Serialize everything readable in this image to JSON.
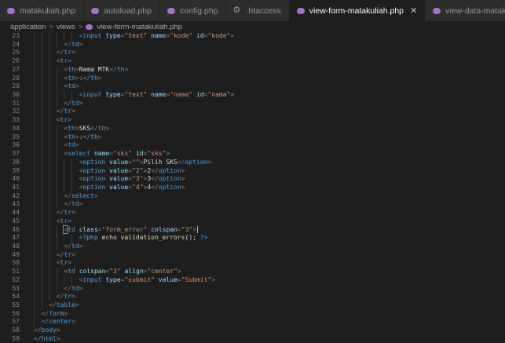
{
  "tabs": [
    {
      "label": "matakuliah.php",
      "icon": "php-icon",
      "active": false
    },
    {
      "label": "autoload.php",
      "icon": "php-icon",
      "active": false
    },
    {
      "label": "config.php",
      "icon": "php-icon",
      "active": false
    },
    {
      "label": ".htaccess",
      "icon": "gear-icon",
      "active": false
    },
    {
      "label": "view-form-matakuliah.php",
      "icon": "php-icon",
      "active": true
    },
    {
      "label": "view-data-matakuliah.php",
      "icon": "php-icon",
      "active": false
    }
  ],
  "close_glyph": "✕",
  "breadcrumb": {
    "items": [
      "application",
      "views",
      "view-form-matakuliah.php"
    ],
    "separator": ">"
  },
  "colors": {
    "tag": "#569cd6",
    "attribute": "#9cdcfe",
    "string": "#ce9178",
    "text": "#d4d4d4",
    "function": "#dcdcaa",
    "line_number": "#858585",
    "php_icon": "#a074c4"
  },
  "lines": [
    {
      "n": "23",
      "indent": 12,
      "tokens": [
        [
          "t",
          "<"
        ],
        [
          "tag",
          "input"
        ],
        [
          "t",
          " "
        ],
        [
          "attr",
          "type"
        ],
        [
          "t",
          "="
        ],
        [
          "str",
          "\"text\""
        ],
        [
          "t",
          " "
        ],
        [
          "attr",
          "name"
        ],
        [
          "t",
          "="
        ],
        [
          "str",
          "\"kode\""
        ],
        [
          "t",
          " "
        ],
        [
          "attr",
          "id"
        ],
        [
          "t",
          "="
        ],
        [
          "str",
          "\"kode\""
        ],
        [
          "t",
          ">"
        ]
      ]
    },
    {
      "n": "24",
      "indent": 8,
      "tokens": [
        [
          "t",
          "</"
        ],
        [
          "tag",
          "td"
        ],
        [
          "t",
          ">"
        ]
      ]
    },
    {
      "n": "25",
      "indent": 6,
      "tokens": [
        [
          "t",
          "</"
        ],
        [
          "tag",
          "tr"
        ],
        [
          "t",
          ">"
        ]
      ]
    },
    {
      "n": "26",
      "indent": 6,
      "tokens": [
        [
          "t",
          "<"
        ],
        [
          "tag",
          "tr"
        ],
        [
          "t",
          ">"
        ]
      ]
    },
    {
      "n": "27",
      "indent": 8,
      "tokens": [
        [
          "t",
          "<"
        ],
        [
          "tag",
          "th"
        ],
        [
          "t",
          ">"
        ],
        [
          "txt",
          "Nama MTK"
        ],
        [
          "t",
          "</"
        ],
        [
          "tag",
          "th"
        ],
        [
          "t",
          ">"
        ]
      ]
    },
    {
      "n": "28",
      "indent": 8,
      "tokens": [
        [
          "t",
          "<"
        ],
        [
          "tag",
          "th"
        ],
        [
          "t",
          ">"
        ],
        [
          "txt",
          ":"
        ],
        [
          "t",
          "</"
        ],
        [
          "tag",
          "th"
        ],
        [
          "t",
          ">"
        ]
      ]
    },
    {
      "n": "29",
      "indent": 8,
      "tokens": [
        [
          "t",
          "<"
        ],
        [
          "tag",
          "td"
        ],
        [
          "t",
          ">"
        ]
      ]
    },
    {
      "n": "30",
      "indent": 12,
      "tokens": [
        [
          "t",
          "<"
        ],
        [
          "tag",
          "input"
        ],
        [
          "t",
          " "
        ],
        [
          "attr",
          "type"
        ],
        [
          "t",
          "="
        ],
        [
          "str",
          "\"text\""
        ],
        [
          "t",
          " "
        ],
        [
          "attr",
          "name"
        ],
        [
          "t",
          "="
        ],
        [
          "str",
          "\"nama\""
        ],
        [
          "t",
          " "
        ],
        [
          "attr",
          "id"
        ],
        [
          "t",
          "="
        ],
        [
          "str",
          "\"nama\""
        ],
        [
          "t",
          ">"
        ]
      ]
    },
    {
      "n": "31",
      "indent": 8,
      "tokens": [
        [
          "t",
          "</"
        ],
        [
          "tag",
          "td"
        ],
        [
          "t",
          ">"
        ]
      ]
    },
    {
      "n": "32",
      "indent": 6,
      "tokens": [
        [
          "t",
          "</"
        ],
        [
          "tag",
          "tr"
        ],
        [
          "t",
          ">"
        ]
      ]
    },
    {
      "n": "33",
      "indent": 6,
      "tokens": [
        [
          "t",
          "<"
        ],
        [
          "tag",
          "tr"
        ],
        [
          "t",
          ">"
        ]
      ]
    },
    {
      "n": "34",
      "indent": 8,
      "tokens": [
        [
          "t",
          "<"
        ],
        [
          "tag",
          "th"
        ],
        [
          "t",
          ">"
        ],
        [
          "txt",
          "SKS"
        ],
        [
          "t",
          "</"
        ],
        [
          "tag",
          "th"
        ],
        [
          "t",
          ">"
        ]
      ]
    },
    {
      "n": "35",
      "indent": 8,
      "tokens": [
        [
          "t",
          "<"
        ],
        [
          "tag",
          "th"
        ],
        [
          "t",
          ">"
        ],
        [
          "txt",
          ":"
        ],
        [
          "t",
          "</"
        ],
        [
          "tag",
          "th"
        ],
        [
          "t",
          ">"
        ]
      ]
    },
    {
      "n": "36",
      "indent": 8,
      "tokens": [
        [
          "t",
          "<"
        ],
        [
          "tag",
          "td"
        ],
        [
          "t",
          ">"
        ]
      ]
    },
    {
      "n": "37",
      "indent": 8,
      "tokens": [
        [
          "t",
          "<"
        ],
        [
          "tag",
          "select"
        ],
        [
          "t",
          " "
        ],
        [
          "attr",
          "name"
        ],
        [
          "t",
          "="
        ],
        [
          "str",
          "\"sks\""
        ],
        [
          "t",
          " "
        ],
        [
          "attr",
          "id"
        ],
        [
          "t",
          "="
        ],
        [
          "str",
          "\"sks\""
        ],
        [
          "t",
          ">"
        ]
      ]
    },
    {
      "n": "38",
      "indent": 12,
      "tokens": [
        [
          "t",
          "<"
        ],
        [
          "tag",
          "option"
        ],
        [
          "t",
          " "
        ],
        [
          "attr",
          "value"
        ],
        [
          "t",
          "="
        ],
        [
          "str",
          "\"\""
        ],
        [
          "t",
          ">"
        ],
        [
          "txt",
          "Pilih SKS"
        ],
        [
          "t",
          "</"
        ],
        [
          "tag",
          "option"
        ],
        [
          "t",
          ">"
        ]
      ]
    },
    {
      "n": "39",
      "indent": 12,
      "tokens": [
        [
          "t",
          "<"
        ],
        [
          "tag",
          "option"
        ],
        [
          "t",
          " "
        ],
        [
          "attr",
          "value"
        ],
        [
          "t",
          "="
        ],
        [
          "str",
          "\"2\""
        ],
        [
          "t",
          ">"
        ],
        [
          "txt",
          "2"
        ],
        [
          "t",
          "</"
        ],
        [
          "tag",
          "option"
        ],
        [
          "t",
          ">"
        ]
      ]
    },
    {
      "n": "40",
      "indent": 12,
      "tokens": [
        [
          "t",
          "<"
        ],
        [
          "tag",
          "option"
        ],
        [
          "t",
          " "
        ],
        [
          "attr",
          "value"
        ],
        [
          "t",
          "="
        ],
        [
          "str",
          "\"3\""
        ],
        [
          "t",
          ">"
        ],
        [
          "txt",
          "3"
        ],
        [
          "t",
          "</"
        ],
        [
          "tag",
          "option"
        ],
        [
          "t",
          ">"
        ]
      ]
    },
    {
      "n": "41",
      "indent": 12,
      "tokens": [
        [
          "t",
          "<"
        ],
        [
          "tag",
          "option"
        ],
        [
          "t",
          " "
        ],
        [
          "attr",
          "value"
        ],
        [
          "t",
          "="
        ],
        [
          "str",
          "\"4\""
        ],
        [
          "t",
          ">"
        ],
        [
          "txt",
          "4"
        ],
        [
          "t",
          "</"
        ],
        [
          "tag",
          "option"
        ],
        [
          "t",
          ">"
        ]
      ]
    },
    {
      "n": "42",
      "indent": 8,
      "tokens": [
        [
          "t",
          "</"
        ],
        [
          "tag",
          "select"
        ],
        [
          "t",
          ">"
        ]
      ]
    },
    {
      "n": "43",
      "indent": 8,
      "tokens": [
        [
          "t",
          "</"
        ],
        [
          "tag",
          "td"
        ],
        [
          "t",
          ">"
        ]
      ]
    },
    {
      "n": "44",
      "indent": 6,
      "tokens": [
        [
          "t",
          "</"
        ],
        [
          "tag",
          "tr"
        ],
        [
          "t",
          ">"
        ]
      ]
    },
    {
      "n": "45",
      "indent": 6,
      "tokens": [
        [
          "t",
          "<"
        ],
        [
          "tag",
          "tr"
        ],
        [
          "t",
          ">"
        ]
      ]
    },
    {
      "n": "46",
      "indent": 8,
      "cursor": true,
      "tokens": [
        [
          "t",
          "<"
        ],
        [
          "tag",
          "td"
        ],
        [
          "t",
          " "
        ],
        [
          "attr",
          "class"
        ],
        [
          "t",
          "="
        ],
        [
          "str",
          "\"form_error\""
        ],
        [
          "t",
          " "
        ],
        [
          "attr",
          "colspan"
        ],
        [
          "t",
          "="
        ],
        [
          "str",
          "\"3\""
        ],
        [
          "t",
          ">"
        ]
      ]
    },
    {
      "n": "47",
      "indent": 12,
      "tokens": [
        [
          "php",
          "<?php"
        ],
        [
          "t",
          " "
        ],
        [
          "txt",
          "echo"
        ],
        [
          "t",
          " "
        ],
        [
          "fn",
          "validation_errors"
        ],
        [
          "txt",
          "();"
        ],
        [
          "t",
          " "
        ],
        [
          "php",
          "?>"
        ]
      ]
    },
    {
      "n": "48",
      "indent": 8,
      "tokens": [
        [
          "t",
          "</"
        ],
        [
          "tag",
          "td"
        ],
        [
          "t",
          ">"
        ]
      ]
    },
    {
      "n": "49",
      "indent": 6,
      "tokens": [
        [
          "t",
          "</"
        ],
        [
          "tag",
          "tr"
        ],
        [
          "t",
          ">"
        ]
      ]
    },
    {
      "n": "50",
      "indent": 6,
      "tokens": [
        [
          "t",
          "<"
        ],
        [
          "tag",
          "tr"
        ],
        [
          "t",
          ">"
        ]
      ]
    },
    {
      "n": "51",
      "indent": 8,
      "tokens": [
        [
          "t",
          "<"
        ],
        [
          "tag",
          "td"
        ],
        [
          "t",
          " "
        ],
        [
          "attr",
          "colspan"
        ],
        [
          "t",
          "="
        ],
        [
          "str",
          "\"3\""
        ],
        [
          "t",
          " "
        ],
        [
          "attr",
          "align"
        ],
        [
          "t",
          "="
        ],
        [
          "str",
          "\"center\""
        ],
        [
          "t",
          ">"
        ]
      ]
    },
    {
      "n": "52",
      "indent": 12,
      "tokens": [
        [
          "t",
          "<"
        ],
        [
          "tag",
          "input"
        ],
        [
          "t",
          " "
        ],
        [
          "attr",
          "type"
        ],
        [
          "t",
          "="
        ],
        [
          "str",
          "\"submit\""
        ],
        [
          "t",
          " "
        ],
        [
          "attr",
          "value"
        ],
        [
          "t",
          "="
        ],
        [
          "str",
          "\"Submit\""
        ],
        [
          "t",
          ">"
        ]
      ]
    },
    {
      "n": "53",
      "indent": 8,
      "tokens": [
        [
          "t",
          "</"
        ],
        [
          "tag",
          "td"
        ],
        [
          "t",
          ">"
        ]
      ]
    },
    {
      "n": "54",
      "indent": 6,
      "tokens": [
        [
          "t",
          "</"
        ],
        [
          "tag",
          "tr"
        ],
        [
          "t",
          ">"
        ]
      ]
    },
    {
      "n": "55",
      "indent": 4,
      "tokens": [
        [
          "t",
          "</"
        ],
        [
          "tag",
          "table"
        ],
        [
          "t",
          ">"
        ]
      ]
    },
    {
      "n": "56",
      "indent": 2,
      "tokens": [
        [
          "t",
          "</"
        ],
        [
          "tag",
          "form"
        ],
        [
          "t",
          ">"
        ]
      ]
    },
    {
      "n": "57",
      "indent": 2,
      "tokens": [
        [
          "t",
          "</"
        ],
        [
          "tag",
          "center"
        ],
        [
          "t",
          ">"
        ]
      ]
    },
    {
      "n": "58",
      "indent": 0,
      "tokens": [
        [
          "t",
          "</"
        ],
        [
          "tag",
          "body"
        ],
        [
          "t",
          ">"
        ]
      ]
    },
    {
      "n": "59",
      "indent": 0,
      "tokens": [
        [
          "t",
          "</"
        ],
        [
          "tag",
          "html"
        ],
        [
          "t",
          ">"
        ]
      ]
    }
  ]
}
